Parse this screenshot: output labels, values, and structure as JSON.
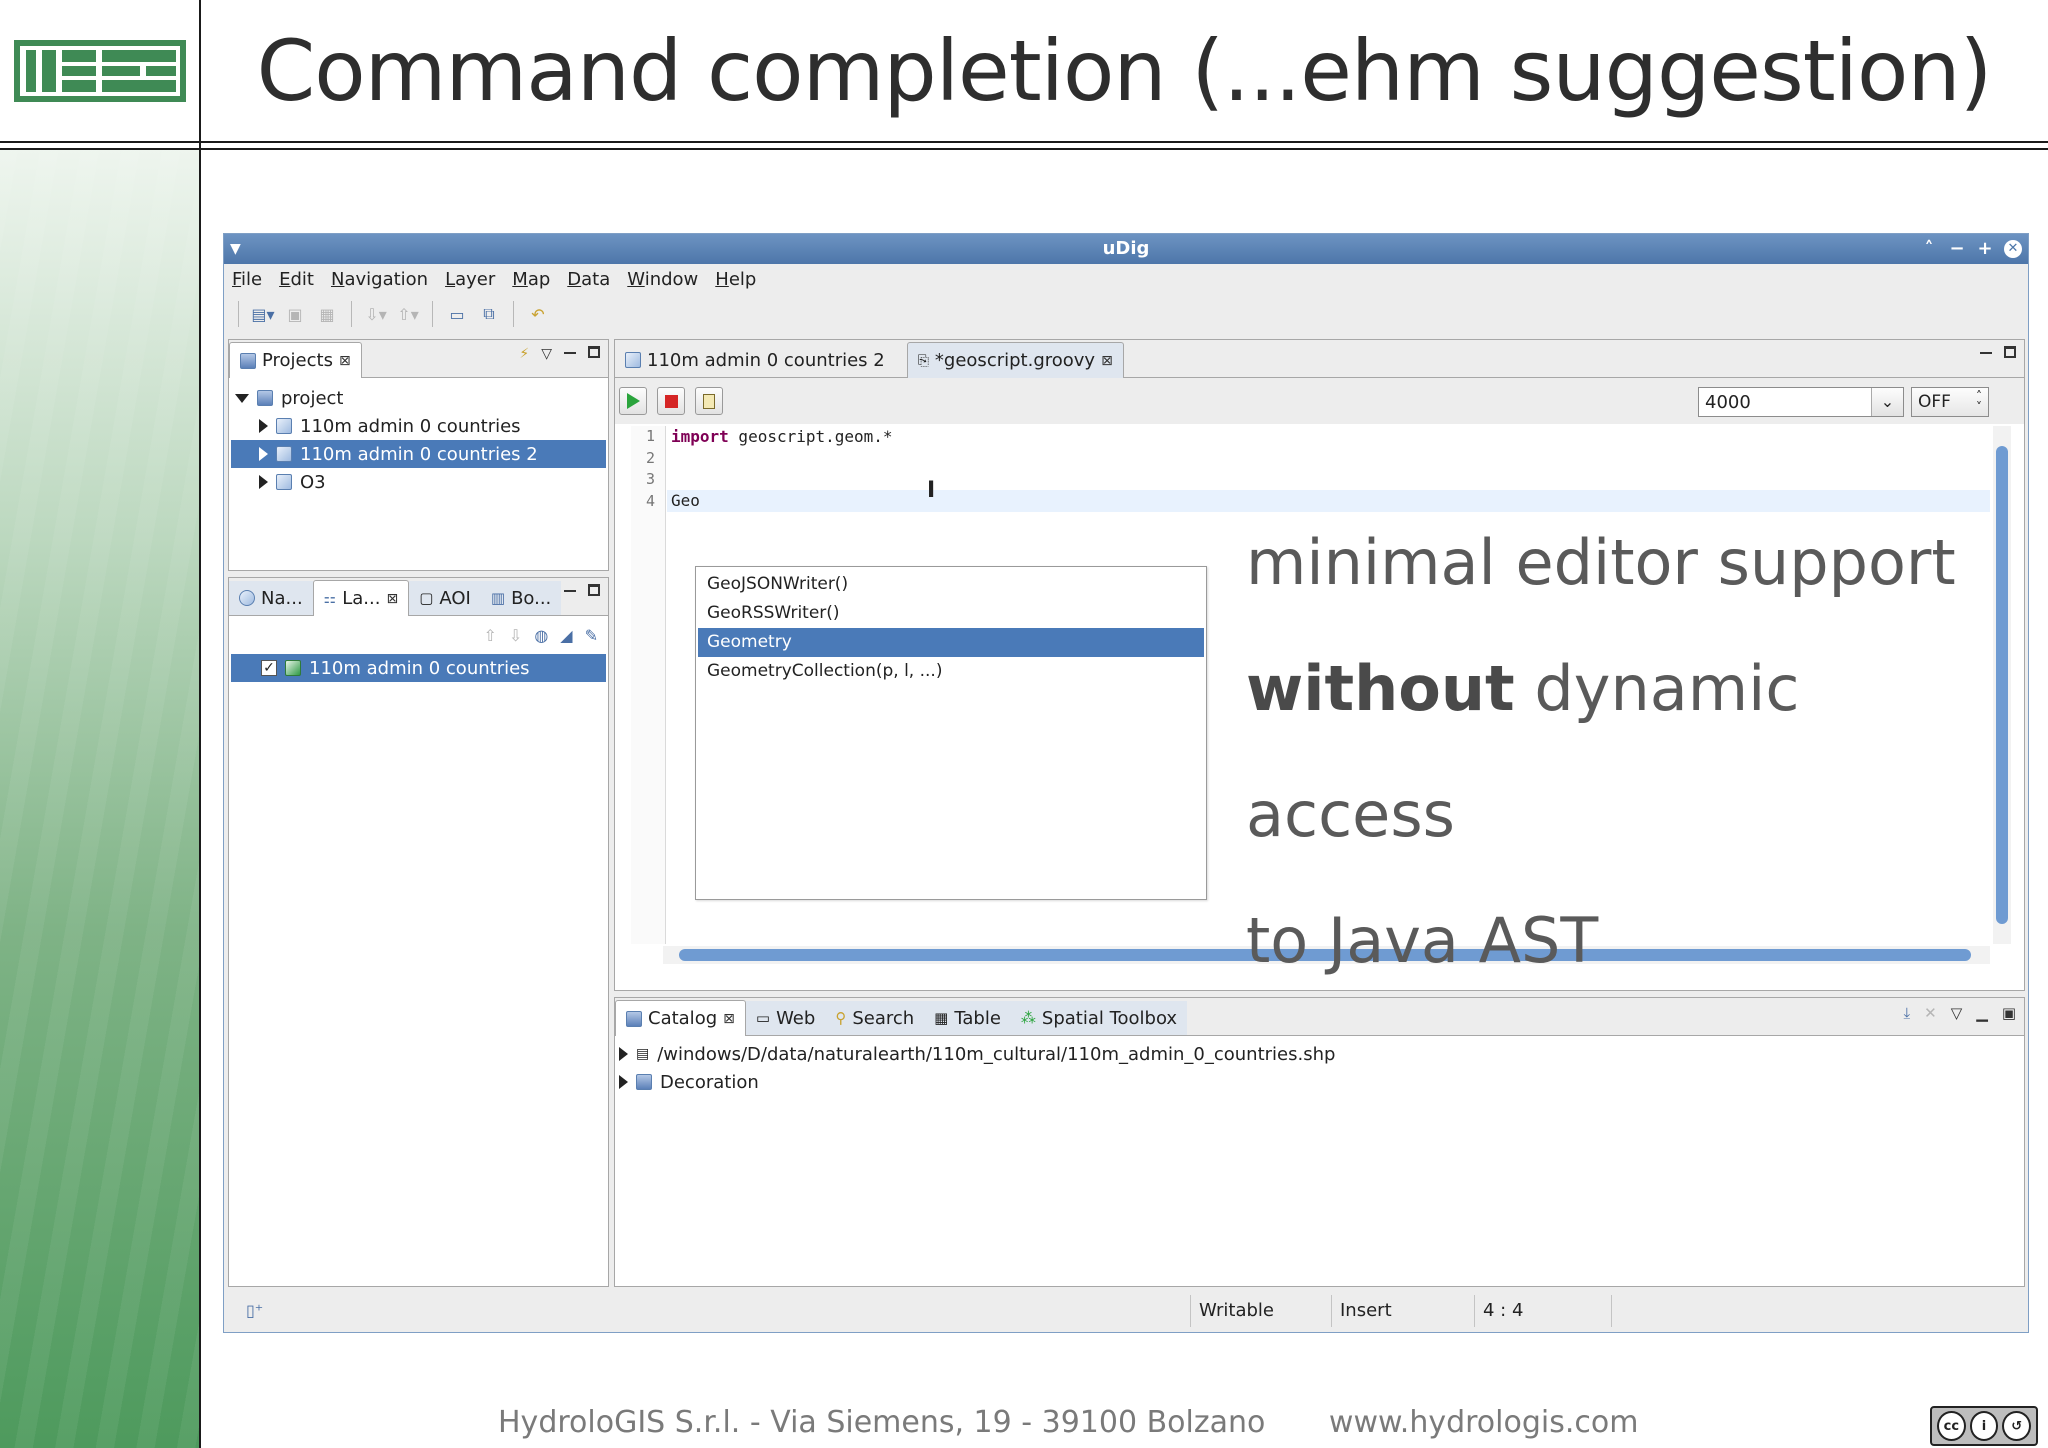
{
  "slide": {
    "title": "Command completion (...ehm suggestion)",
    "footer_company": "HydroloGIS S.r.l. - Via Siemens, 19 - 39100 Bolzano",
    "footer_url": "www.hydrologis.com",
    "license_badge": "BY SA"
  },
  "window": {
    "title": "uDig",
    "menus": [
      "File",
      "Edit",
      "Navigation",
      "Layer",
      "Map",
      "Data",
      "Window",
      "Help"
    ]
  },
  "projects_panel": {
    "tab_label": "Projects",
    "root": "project",
    "items": [
      "110m admin 0 countries",
      "110m admin 0 countries 2",
      "O3"
    ],
    "selected_index": 1
  },
  "layers_panel": {
    "tabs": [
      "Na...",
      "La...",
      "AOI",
      "Bo..."
    ],
    "layer": "110m admin 0 countries"
  },
  "editor": {
    "tabs": [
      "110m admin 0 countries 2",
      "*geoscript.groovy"
    ],
    "memory_value": "4000",
    "toggle_value": "OFF",
    "line_numbers": [
      "1",
      "2",
      "3",
      "4"
    ],
    "line1_keyword": "import",
    "line1_rest": " geoscript.geom.*",
    "line4": "Geo",
    "completions": [
      "GeoJSONWriter()",
      "GeoRSSWriter()",
      "Geometry",
      "GeometryCollection(p, l, ...)"
    ],
    "selected_completion": 2
  },
  "overlay": {
    "line1": "minimal editor support",
    "line2_bold": "without",
    "line2_rest": " dynamic access",
    "line3": "to Java AST"
  },
  "catalog_panel": {
    "tabs": [
      "Catalog",
      "Web",
      "Search",
      "Table",
      "Spatial Toolbox"
    ],
    "items": [
      "/windows/D/data/naturalearth/110m_cultural/110m_admin_0_countries.shp",
      "Decoration"
    ]
  },
  "statusbar": {
    "writable": "Writable",
    "mode": "Insert",
    "position": "4 : 4"
  },
  "colors": {
    "selection": "#4a7ab8",
    "titlebar": "#5a82b4",
    "keyword": "#7f0055"
  }
}
